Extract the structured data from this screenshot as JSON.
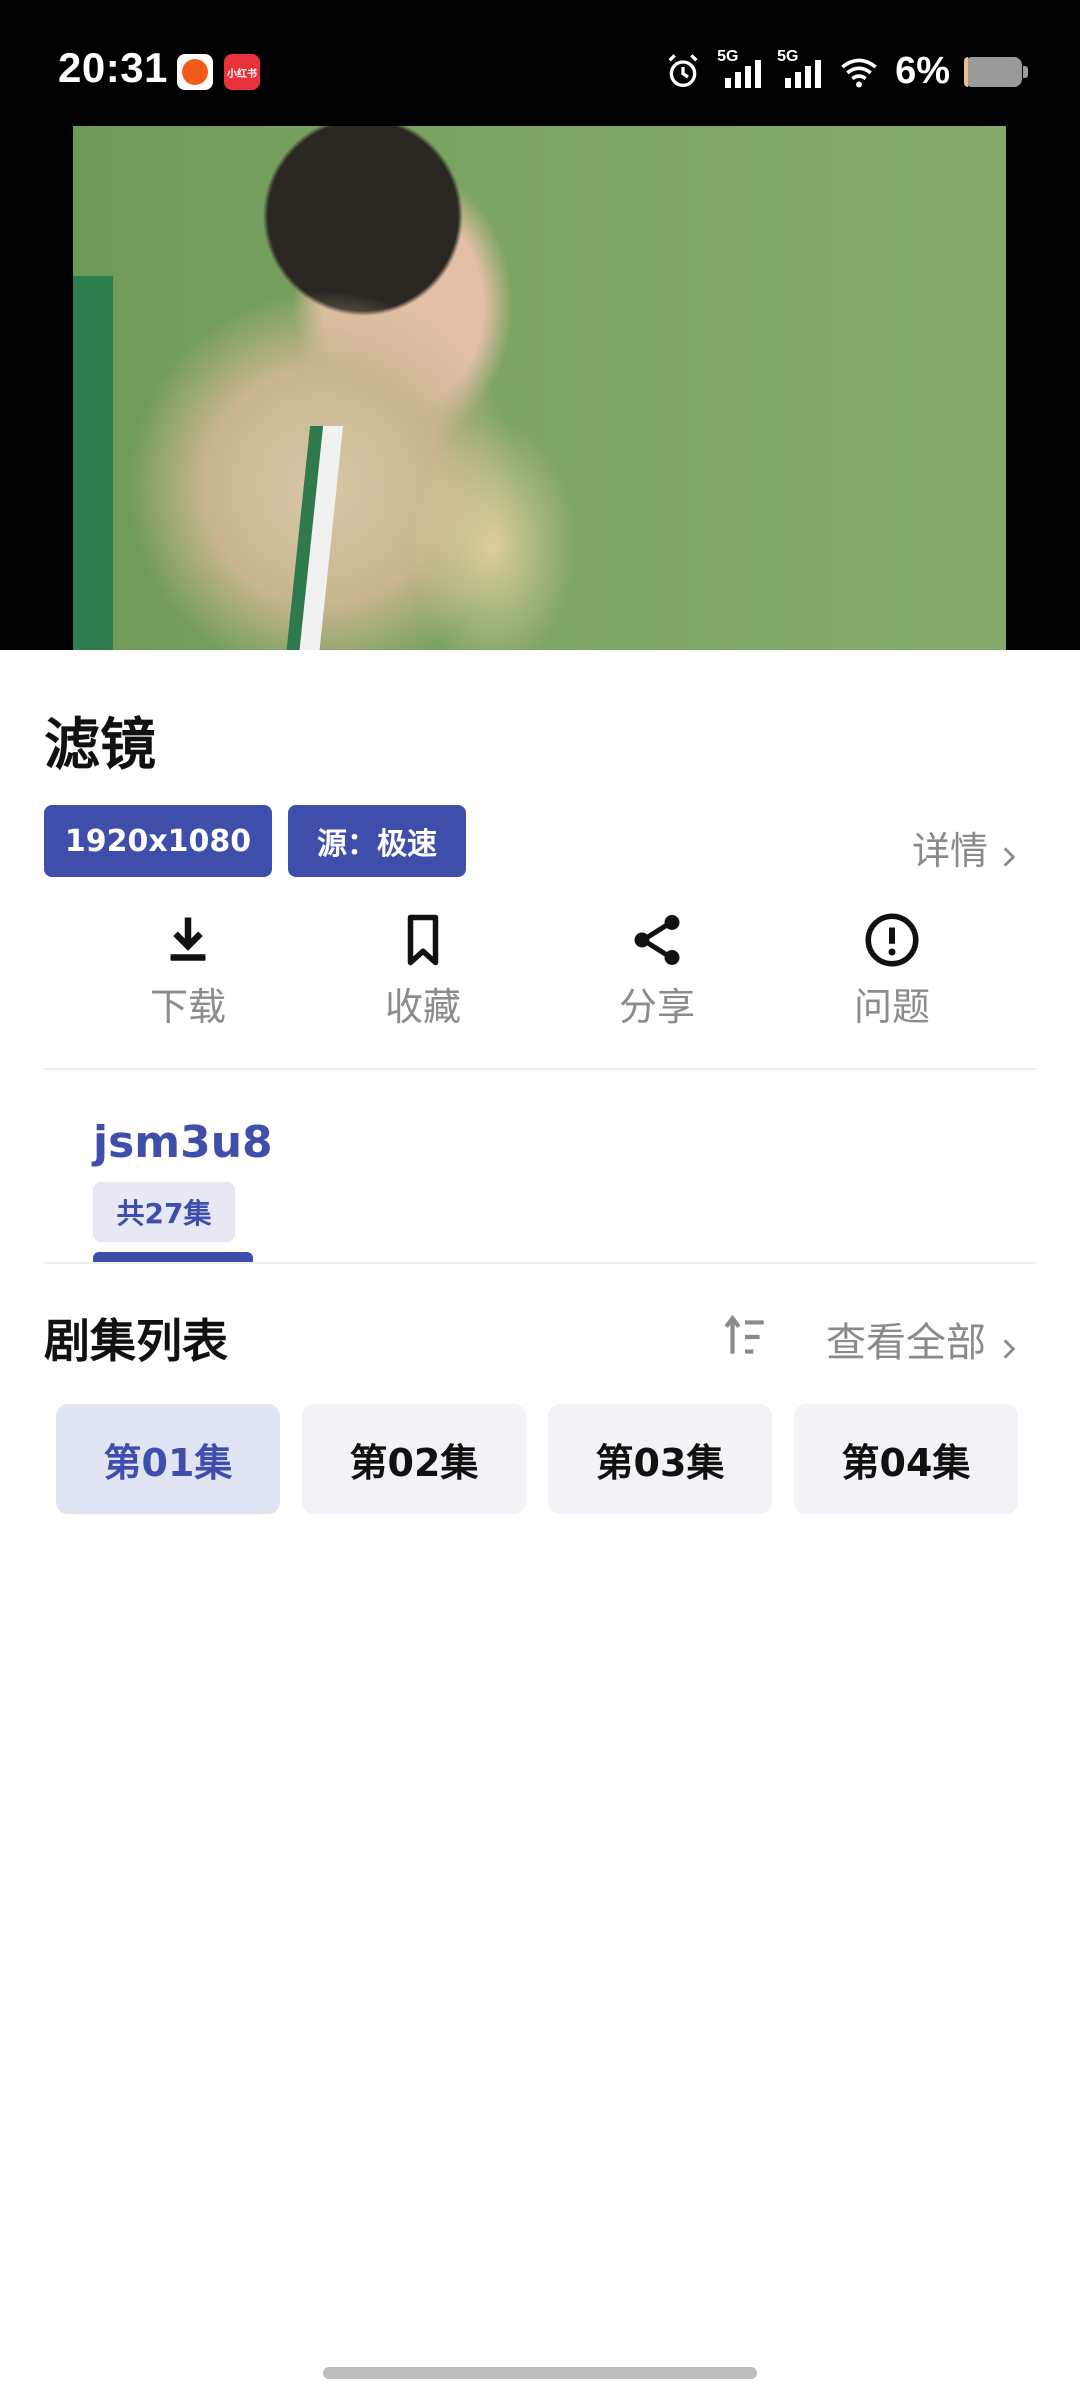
{
  "status_bar": {
    "time": "20:31",
    "app_badge_2": "小红书",
    "signal_1": "5G",
    "signal_2": "5G",
    "battery": "6%",
    "battery_level": 0.06
  },
  "video": {
    "title": "滤镜"
  },
  "tags": {
    "resolution": "1920x1080",
    "source": "源：极速"
  },
  "detail_link": "详情",
  "actions": [
    {
      "label": "下载",
      "icon": "download-icon"
    },
    {
      "label": "收藏",
      "icon": "bookmark-icon"
    },
    {
      "label": "分享",
      "icon": "share-icon"
    },
    {
      "label": "问题",
      "icon": "alert-circle-icon"
    }
  ],
  "source_tab": {
    "name": "jsm3u8",
    "count": "共27集"
  },
  "episodes": {
    "header": "剧集列表",
    "view_all": "查看全部",
    "items": [
      "第01集",
      "第02集",
      "第03集",
      "第04集"
    ]
  },
  "colors": {
    "accent": "#3f4dab",
    "chip_bg": "#e6e8f3"
  }
}
